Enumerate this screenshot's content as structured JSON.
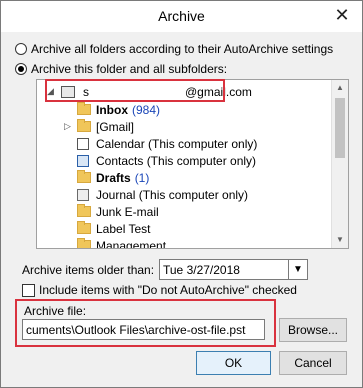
{
  "window": {
    "title": "Archive",
    "close_glyph": "✕"
  },
  "options": {
    "archive_all_label": "Archive all folders according to their AutoArchive settings",
    "archive_this_label": "Archive this folder and all subfolders:"
  },
  "tree": {
    "account": "s        @gmail.com",
    "items": [
      {
        "label": "Inbox",
        "count": "(984)"
      },
      {
        "label": "[Gmail]"
      },
      {
        "label": "Calendar (This computer only)"
      },
      {
        "label": "Contacts (This computer only)"
      },
      {
        "label": "Drafts",
        "count": "(1)"
      },
      {
        "label": "Journal (This computer only)"
      },
      {
        "label": "Junk E-mail"
      },
      {
        "label": "Label Test"
      },
      {
        "label": "Management"
      }
    ]
  },
  "older_than": {
    "label": "Archive items older than:",
    "value": "Tue 3/27/2018"
  },
  "include": {
    "label": "Include items with \"Do not AutoArchive\" checked"
  },
  "archive_file": {
    "label": "Archive file:",
    "value": "cuments\\Outlook Files\\archive-ost-file.pst",
    "browse_label": "Browse..."
  },
  "buttons": {
    "ok": "OK",
    "cancel": "Cancel"
  }
}
